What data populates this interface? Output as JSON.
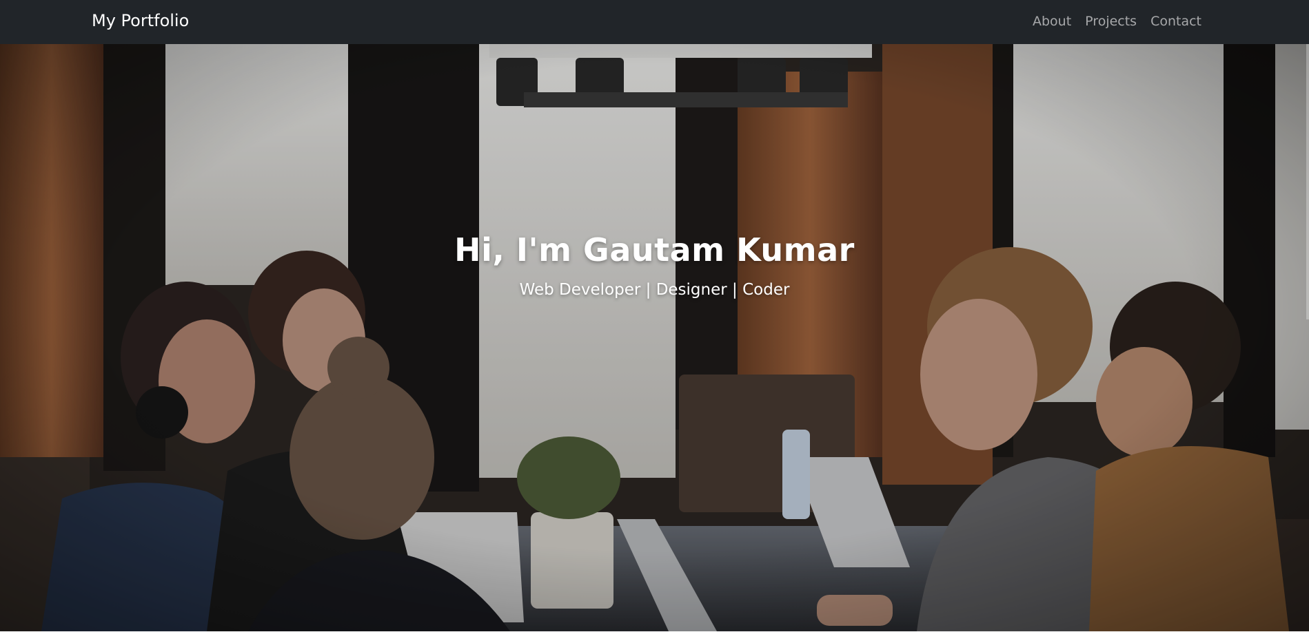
{
  "navbar": {
    "brand": "My Portfolio",
    "links": [
      "About",
      "Projects",
      "Contact"
    ],
    "background_color": "#212529"
  },
  "hero": {
    "title": "Hi, I'm Gautam Kumar",
    "subtitle": "Web Developer | Designer | Coder",
    "image": "photo-of-people-working-on-laptops-at-cafe-table"
  }
}
